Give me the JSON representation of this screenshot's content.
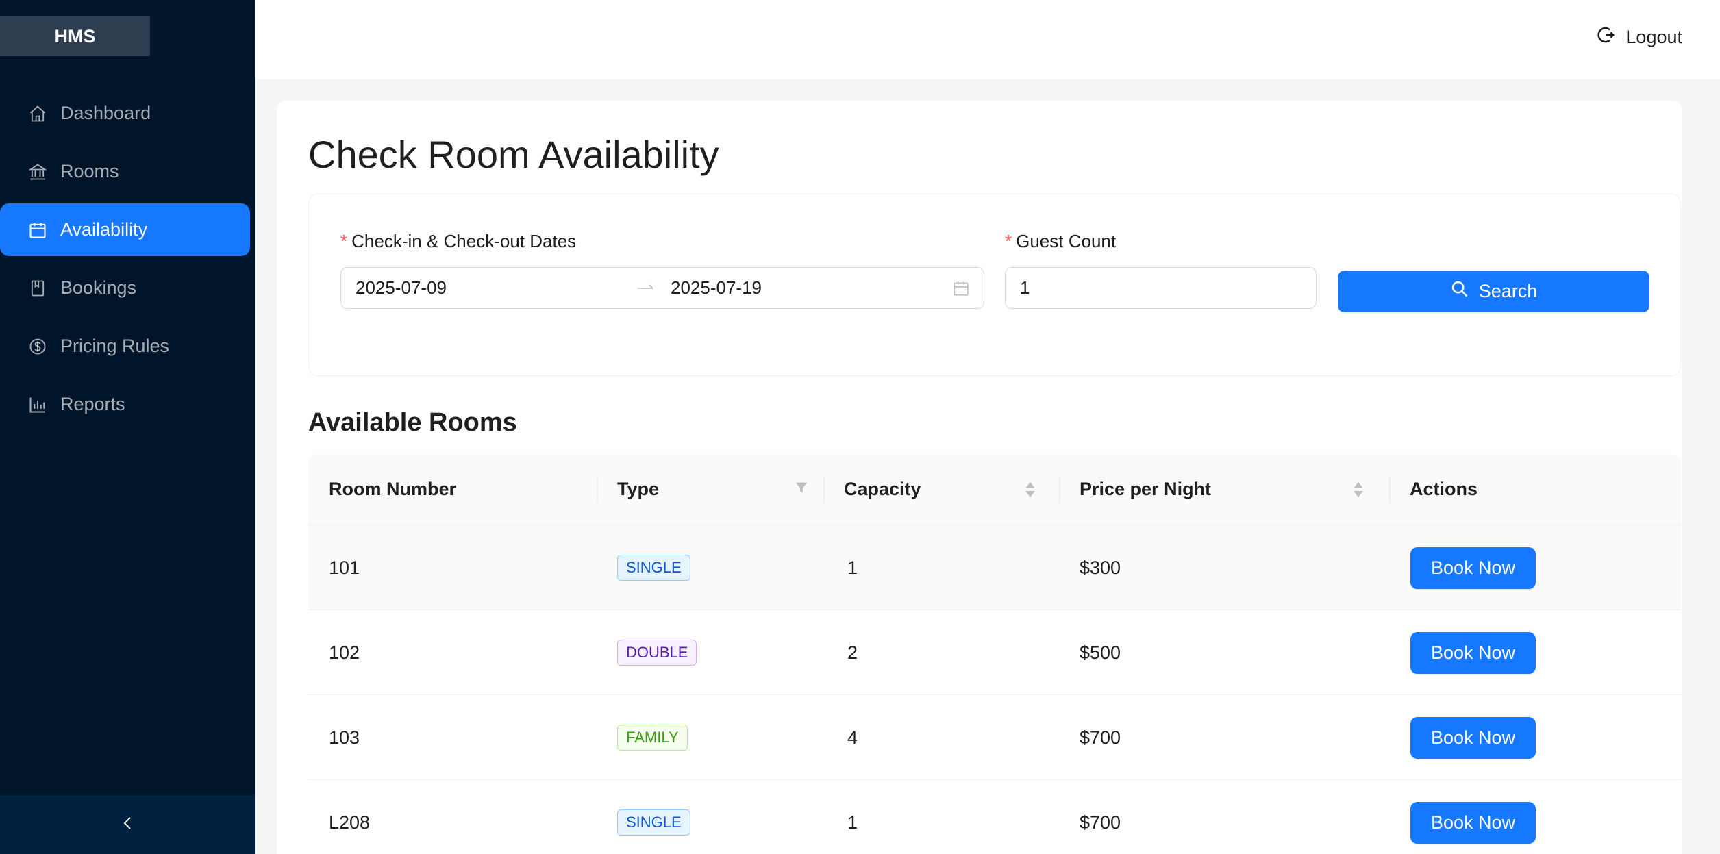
{
  "app": {
    "logo": "HMS"
  },
  "sidebar": {
    "items": [
      {
        "label": "Dashboard",
        "icon": "home-icon",
        "active": false
      },
      {
        "label": "Rooms",
        "icon": "bank-icon",
        "active": false
      },
      {
        "label": "Availability",
        "icon": "calendar-icon",
        "active": true
      },
      {
        "label": "Bookings",
        "icon": "book-icon",
        "active": false
      },
      {
        "label": "Pricing Rules",
        "icon": "dollar-icon",
        "active": false
      },
      {
        "label": "Reports",
        "icon": "bar-chart-icon",
        "active": false
      }
    ],
    "collapse_icon": "chevron-left-icon"
  },
  "header": {
    "logout_label": "Logout",
    "logout_icon": "logout-icon"
  },
  "page": {
    "title": "Check Room Availability"
  },
  "search": {
    "dates_label": "Check-in & Check-out Dates",
    "check_in": "2025-07-09",
    "check_out": "2025-07-19",
    "guest_label": "Guest Count",
    "guest_value": "1",
    "button_label": "Search",
    "required_mark": "*"
  },
  "results": {
    "title": "Available Rooms",
    "columns": [
      "Room Number",
      "Type",
      "Capacity",
      "Price per Night",
      "Actions"
    ],
    "rows": [
      {
        "room": "101",
        "type": "SINGLE",
        "capacity": "1",
        "price": "$300",
        "action": "Book Now"
      },
      {
        "room": "102",
        "type": "DOUBLE",
        "capacity": "2",
        "price": "$500",
        "action": "Book Now"
      },
      {
        "room": "103",
        "type": "FAMILY",
        "capacity": "4",
        "price": "$700",
        "action": "Book Now"
      },
      {
        "room": "L208",
        "type": "SINGLE",
        "capacity": "1",
        "price": "$700",
        "action": "Book Now"
      }
    ]
  },
  "colors": {
    "sidebar_bg": "#001529",
    "primary": "#1677ff",
    "required": "#ff4d4f"
  }
}
